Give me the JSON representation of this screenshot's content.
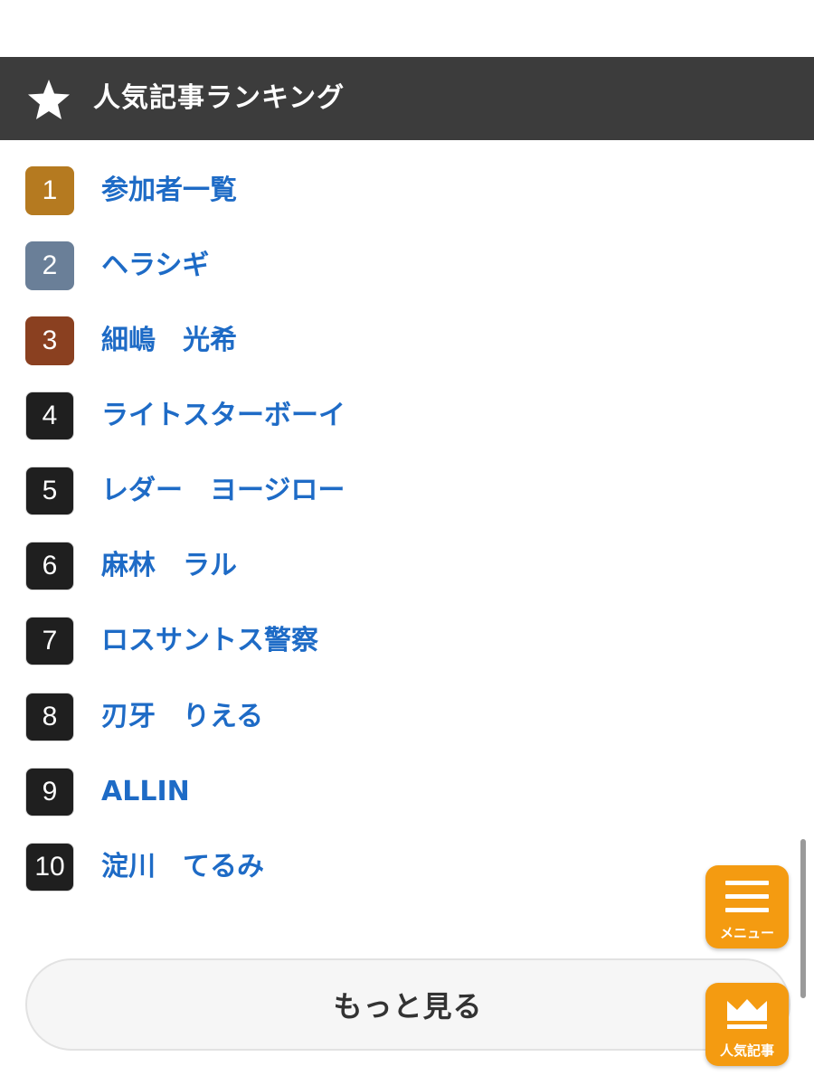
{
  "header": {
    "title": "人気記事ランキング",
    "icon": "star-icon"
  },
  "ranking": [
    {
      "rank": "1",
      "title": "参加者一覧",
      "badge_color": "#b57a20"
    },
    {
      "rank": "2",
      "title": "ヘラシギ",
      "badge_color": "#6a7f98"
    },
    {
      "rank": "3",
      "title": "細嶋　光希",
      "badge_color": "#8a4020"
    },
    {
      "rank": "4",
      "title": "ライトスターボーイ",
      "badge_color": "#1f1f1f"
    },
    {
      "rank": "5",
      "title": "レダー　ヨージロー",
      "badge_color": "#1f1f1f"
    },
    {
      "rank": "6",
      "title": "麻林　ラル",
      "badge_color": "#1f1f1f"
    },
    {
      "rank": "7",
      "title": "ロスサントス警察",
      "badge_color": "#1f1f1f"
    },
    {
      "rank": "8",
      "title": "刃牙　りえる",
      "badge_color": "#1f1f1f"
    },
    {
      "rank": "9",
      "title": "ALLIN",
      "badge_color": "#1f1f1f"
    },
    {
      "rank": "10",
      "title": "淀川　てるみ",
      "badge_color": "#1f1f1f"
    }
  ],
  "more_button": {
    "label": "もっと見る"
  },
  "fab_menu": {
    "label": "メニュー",
    "icon": "hamburger-menu-icon"
  },
  "fab_popular": {
    "label": "人気記事",
    "icon": "crown-icon"
  },
  "colors": {
    "link": "#1e6bc6",
    "header_bg": "#3c3c3c",
    "fab": "#f49b11"
  }
}
